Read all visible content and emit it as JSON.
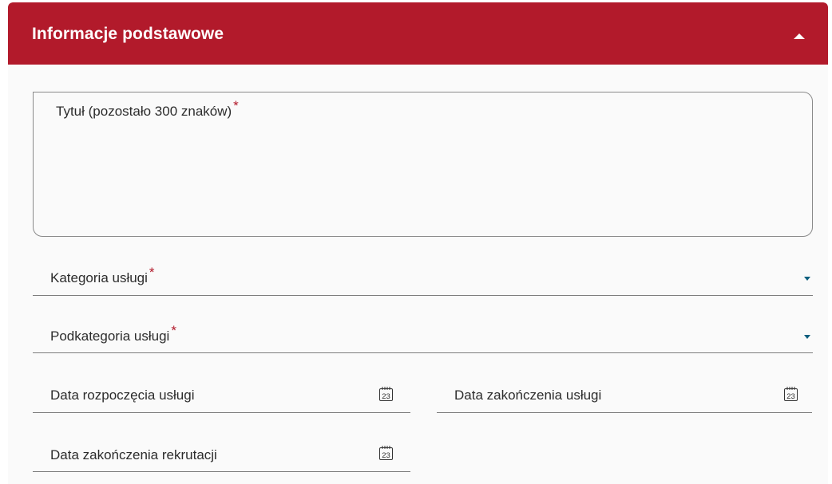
{
  "header": {
    "title": "Informacje podstawowe",
    "collapse_icon": "caret-up-icon"
  },
  "fields": {
    "title": {
      "label": "Tytuł (pozostało 300 znaków)",
      "required_mark": "*",
      "value": ""
    },
    "category": {
      "label": "Kategoria usługi",
      "required_mark": "*",
      "value": ""
    },
    "subcategory": {
      "label": "Podkategoria usługi",
      "required_mark": "*",
      "value": ""
    },
    "start_date": {
      "label": "Data rozpoczęcia usługi",
      "icon": "calendar-icon",
      "icon_text": "23"
    },
    "end_date": {
      "label": "Data zakończenia usługi",
      "icon": "calendar-icon",
      "icon_text": "23"
    },
    "recruitment_end_date": {
      "label": "Data zakończenia rekrutacji",
      "icon": "calendar-icon",
      "icon_text": "23"
    }
  },
  "colors": {
    "accent": "#b21a2b",
    "dropdown_caret": "#0c5e7d",
    "border": "#7b7b7b"
  }
}
